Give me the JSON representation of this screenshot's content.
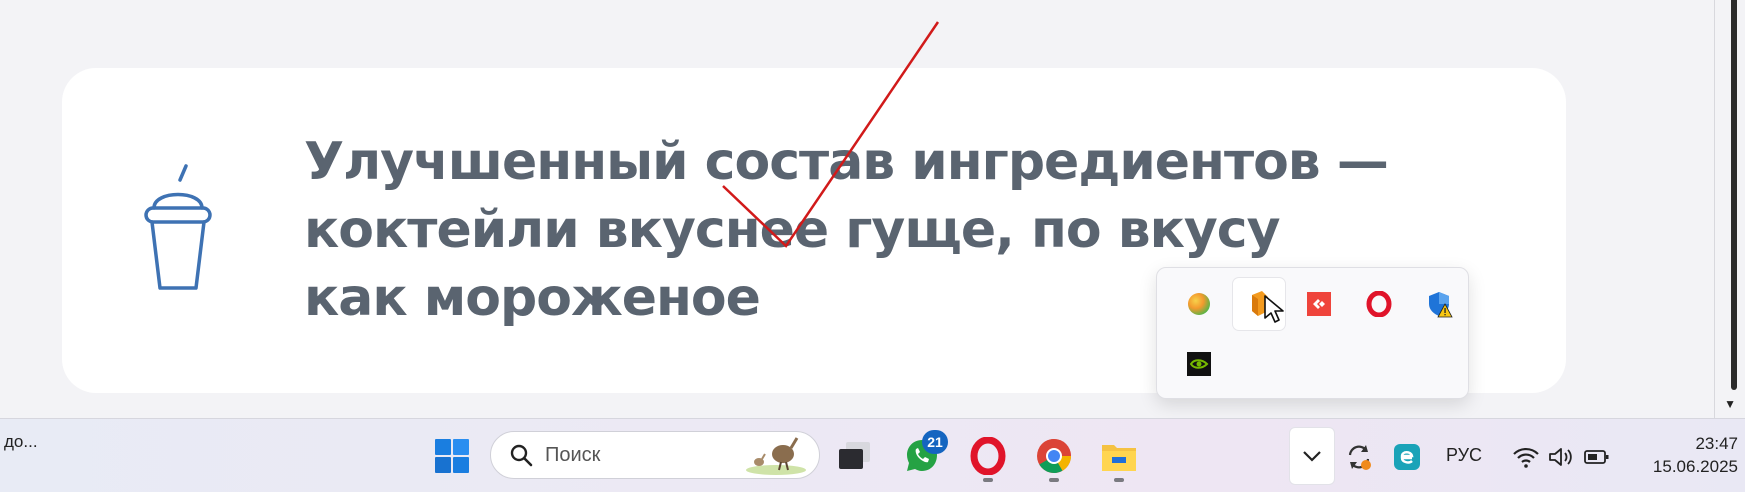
{
  "card": {
    "lines": [
      "Улучшенный состав ингредиентов —",
      "коктейли вкуснее гуще, по вкусу",
      "как мороженое"
    ],
    "icon": "smoothie-cup-icon"
  },
  "tray_popup": {
    "items": [
      {
        "name": "colorful-ball-icon",
        "color": "#f4a52a"
      },
      {
        "name": "orange-cube-app-icon",
        "color": "#f39a1e"
      },
      {
        "name": "anydesk-icon",
        "color": "#ef443b"
      },
      {
        "name": "opera-icon",
        "color": "#e0142a"
      },
      {
        "name": "defender-shield-warning-icon",
        "color": "#1f74d8"
      },
      {
        "name": "nvidia-icon",
        "color": "#76b900"
      }
    ]
  },
  "taskbar": {
    "left_text": "до...",
    "search_placeholder": "Поиск",
    "whatsapp_badge": "21",
    "language": "РУС",
    "time": "23:47",
    "date": "15.06.2025"
  },
  "colors": {
    "accent_blue": "#3e72b3",
    "check_red": "#d11a1a",
    "text_gray": "#5a6470"
  }
}
